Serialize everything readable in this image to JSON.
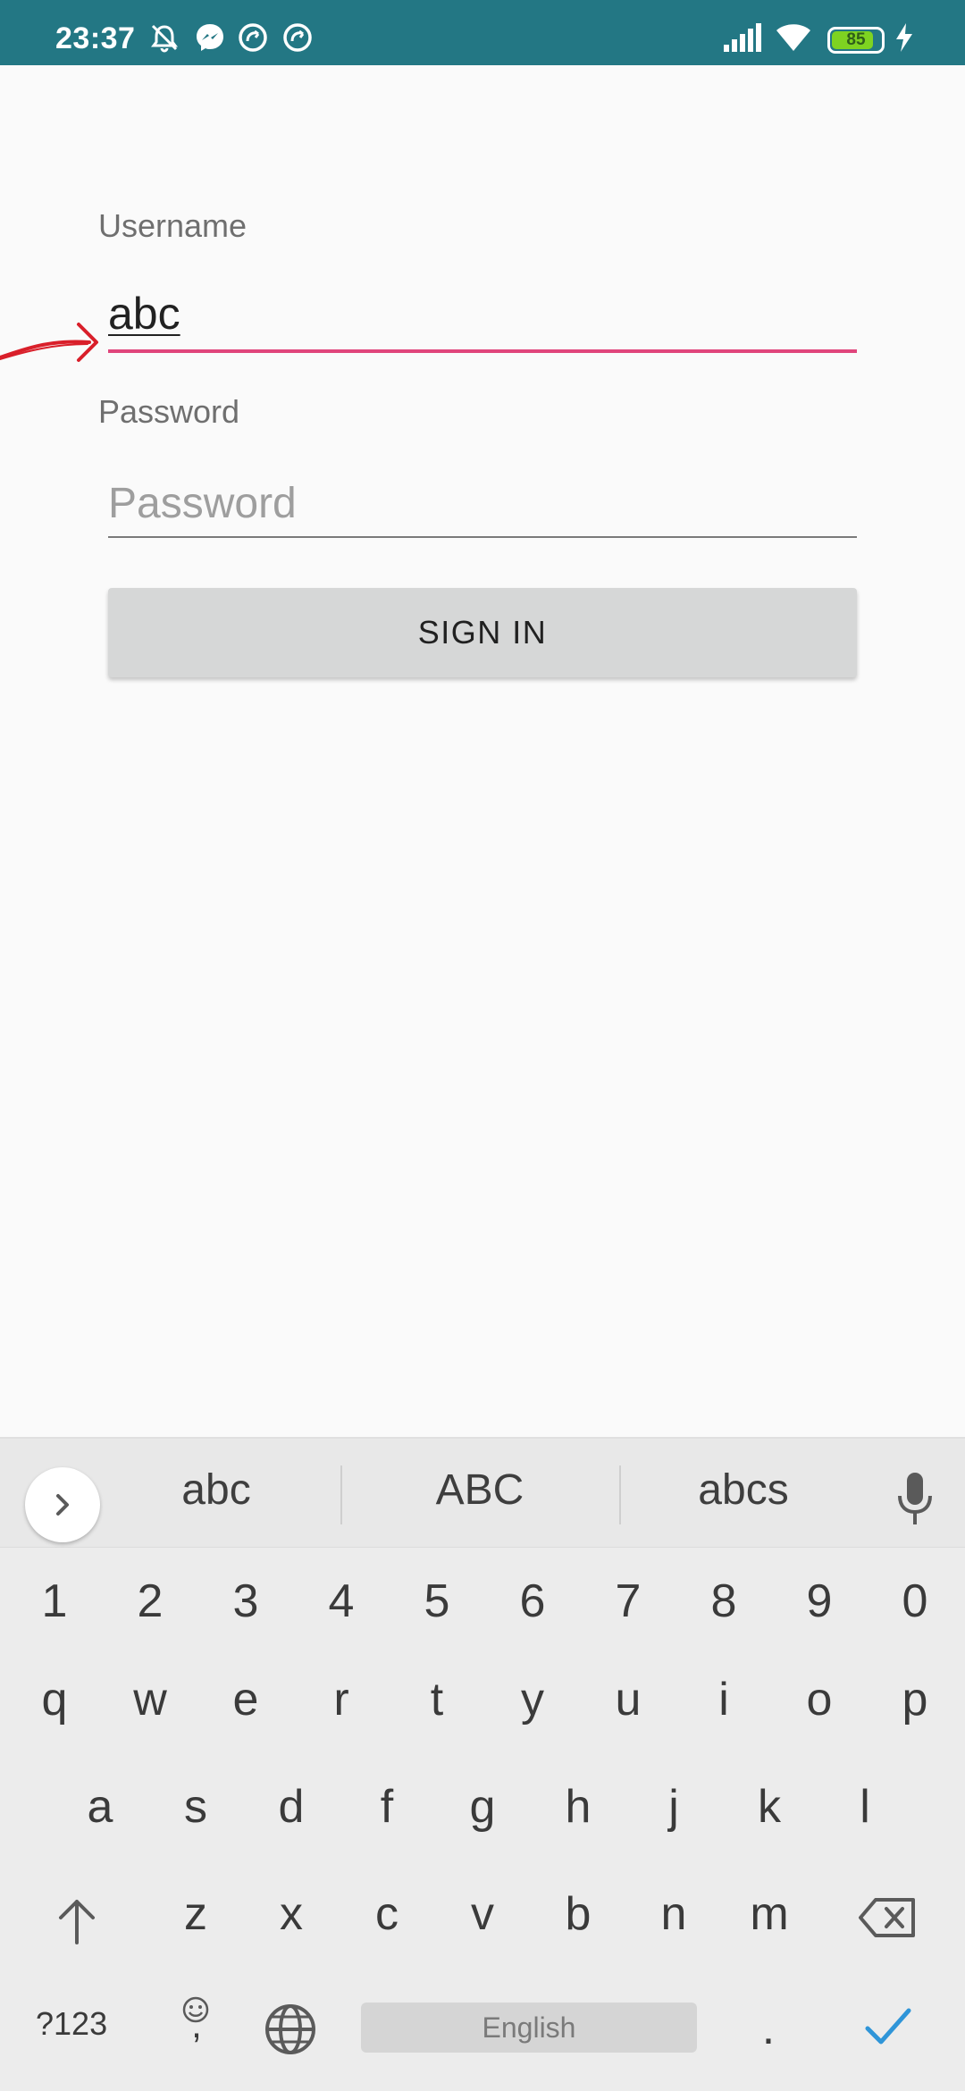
{
  "status_bar": {
    "time": "23:37",
    "battery_level": "85",
    "battery_fraction": 0.85,
    "icons": [
      "alarm-off-icon",
      "messenger-icon",
      "sync-icon",
      "sync-icon",
      "signal-icon",
      "wifi-icon",
      "battery-icon",
      "charging-icon"
    ]
  },
  "form": {
    "username_label": "Username",
    "username_value": "abc",
    "password_label": "Password",
    "password_placeholder": "Password",
    "signin_label": "SIGN IN"
  },
  "colors": {
    "status_bar": "#237784",
    "accent": "#e0457b",
    "button_bg": "#d6d7d7",
    "annotation": "#d91f2a"
  },
  "keyboard": {
    "suggestions": [
      "abc",
      "ABC",
      "abcs"
    ],
    "number_row": [
      "1",
      "2",
      "3",
      "4",
      "5",
      "6",
      "7",
      "8",
      "9",
      "0"
    ],
    "row1": [
      "q",
      "w",
      "e",
      "r",
      "t",
      "y",
      "u",
      "i",
      "o",
      "p"
    ],
    "row2": [
      "a",
      "s",
      "d",
      "f",
      "g",
      "h",
      "j",
      "k",
      "l"
    ],
    "row3": [
      "z",
      "x",
      "c",
      "v",
      "b",
      "n",
      "m"
    ],
    "symbols_label": "?123",
    "comma_label": ",",
    "space_label": "English",
    "period_label": "."
  }
}
